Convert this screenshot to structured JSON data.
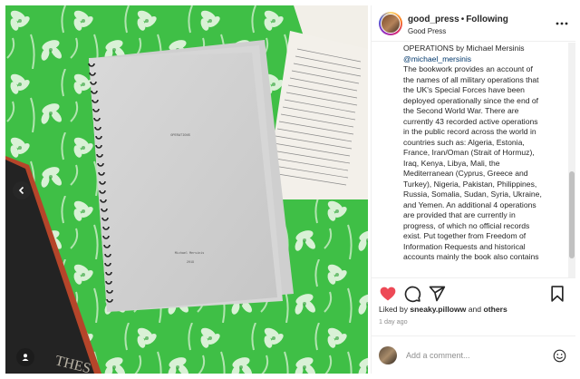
{
  "post": {
    "username": "good_press",
    "separator": "•",
    "follow_label": "Following",
    "subtitle": "Good Press",
    "caption_lines": [
      "OPERATIONS by Michael Mersinis",
      "@michael_mersinis",
      "The bookwork provides an account of",
      "the names of all military operations that",
      "the UK's Special Forces have been",
      "deployed operationally since the end of",
      "the Second World War. There are",
      "currently 43 recorded active operations",
      "in the public record across the world in",
      "countries such as: Algeria, Estonia,",
      "France, Iran/Oman (Strait of Hormuz),",
      "Iraq, Kenya, Libya, Mali, the",
      "Mediterranean (Cyprus, Greece and",
      "Turkey), Nigeria, Pakistan, Philippines,",
      "Russia, Somalia, Sudan, Syria, Ukraine,",
      "and Yemen. An additional 4 operations",
      "are provided that are currently in",
      "progress, of which no official records",
      "exist. Put together from Freedom of",
      "Information Requests and historical",
      "accounts mainly the book also contains"
    ],
    "likes_prefix": "Liked by ",
    "liked_by_user": "sneaky.pilloww",
    "likes_and": " and ",
    "likes_others": "others",
    "time_ago": "1 day ago",
    "comment_placeholder": "Add a comment..."
  },
  "manuscript": {
    "title": "OPERATIONS",
    "author": "Michael Mersinis",
    "year": "2019"
  },
  "book_cover_text": "THES",
  "colors": {
    "green": "#3fbf46",
    "like_red": "#ed4956",
    "link_blue": "#00376b",
    "muted": "#8e8e8e"
  },
  "icons": [
    "chevron-left-icon",
    "user-tag-icon",
    "more-icon",
    "heart-icon",
    "comment-icon",
    "share-icon",
    "bookmark-icon",
    "emoji-icon"
  ]
}
